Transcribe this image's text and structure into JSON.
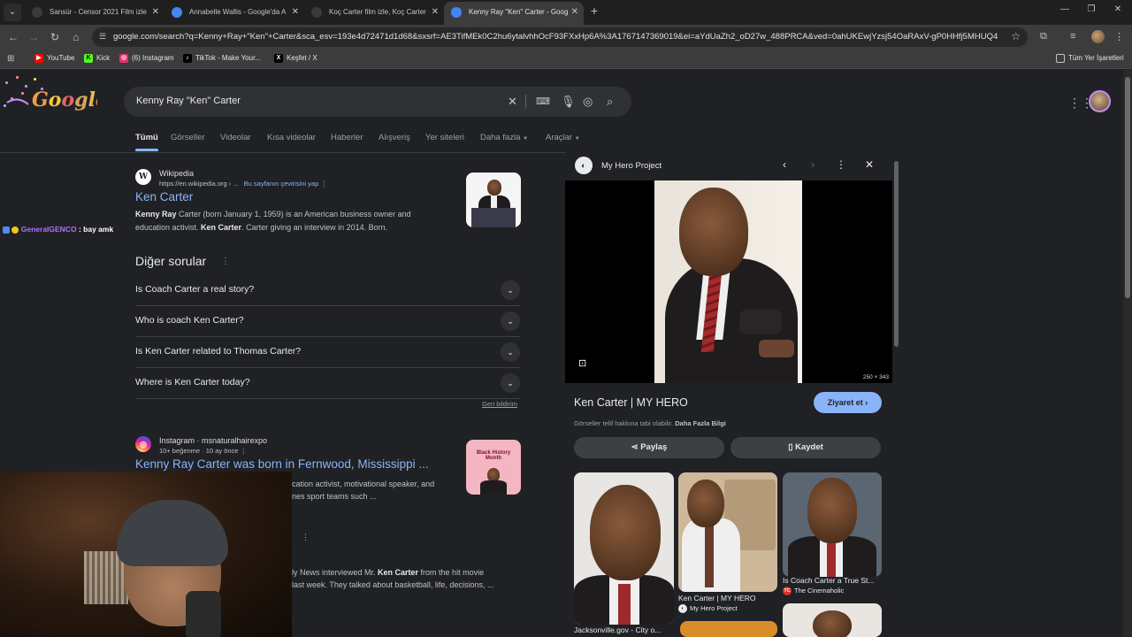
{
  "browser": {
    "tabs": [
      {
        "title": "Sansür - Censor 2021 Film izle",
        "favicon_color": "#3a3a3a",
        "active": false
      },
      {
        "title": "Annabelle Wallis - Google'da A",
        "favicon_color": "#4285f4",
        "active": false
      },
      {
        "title": "Koç Carter film izle, Koç Carter",
        "favicon_color": "#3a3a3a",
        "active": false
      },
      {
        "title": "Kenny Ray \"Ken\" Carter - Goog",
        "favicon_color": "#4285f4",
        "active": true
      }
    ],
    "url": "google.com/search?q=Kenny+Ray+\"Ken\"+Carter&sca_esv=193e4d72471d1d68&sxsrf=AE3TifMEk0C2hu6ytalvhhOcF93FXxHp6A%3A1767147369019&ei=aYdUaZh2_oD27w_488PRCA&ved=0ahUKEwjYzsj54OaRAxV-gP0HHfj5MHUQ4dUDCBI&ua...",
    "bookmarks": [
      {
        "label": "YouTube",
        "color": "#ff0000",
        "glyph": "▶"
      },
      {
        "label": "Kick",
        "color": "#53fc18",
        "glyph": "K"
      },
      {
        "label": "(6) Instagram",
        "color": "#e1306c",
        "glyph": "◎"
      },
      {
        "label": "TikTok - Make Your...",
        "color": "#000000",
        "glyph": "♪"
      },
      {
        "label": "Keşfet / X",
        "color": "#000000",
        "glyph": "X"
      }
    ],
    "all_bookmarks": "Tüm Yer İşaretleri"
  },
  "search": {
    "query": "Kenny Ray \"Ken\" Carter",
    "tabs": [
      "Tümü",
      "Görseller",
      "Videolar",
      "Kısa videolar",
      "Haberler",
      "Alışveriş",
      "Yer siteleri",
      "Daha fazla",
      "Araçlar"
    ]
  },
  "chat_overlay": {
    "user": "GeneralGENCO",
    "message": ": bay amk",
    "user_color": "#a970ff"
  },
  "results": {
    "wiki": {
      "source": "Wikipedia",
      "url": "https://en.wikipedia.org › ...",
      "translate": "Bu sayfanın çevirisini yap",
      "title": "Ken Carter",
      "snippet_parts": [
        {
          "t": "Kenny Ray",
          "b": true
        },
        {
          "t": " Carter (born January 1, 1959) is an American business owner and education activist. ",
          "b": false
        },
        {
          "t": "Ken Carter",
          "b": true
        },
        {
          "t": ". Carter giving an interview in 2014. Born.",
          "b": false
        }
      ]
    },
    "paa": {
      "heading": "Diğer sorular",
      "questions": [
        "Is Coach Carter a real story?",
        "Who is coach Ken Carter?",
        "Is Ken Carter related to Thomas Carter?",
        "Where is Ken Carter today?"
      ],
      "feedback": "Geri bildirim"
    },
    "insta": {
      "source": "Instagram · msnaturalhairexpo",
      "meta": "10+ beğenme · 10 ay önce",
      "title": "Kenny Ray Carter was born in Fernwood, Mississippi ...",
      "snippet_line1": "cation activist, motivational speaker, and",
      "snippet_line2": "nes sport teams such ...",
      "thumb_text": "Black History Month"
    },
    "third": {
      "line1_pre": "ly News interviewed Mr. ",
      "line1_bold": "Ken Carter",
      "line1_post": " from the hit movie",
      "line2": "last week. They talked about basketball, life, decisions, ..."
    }
  },
  "side_panel": {
    "source": "My Hero Project",
    "title": "Ken Carter | MY HERO",
    "visit": "Ziyaret et",
    "copyright": "Görseller telif hakkına tabi olabilir.",
    "more_info": "Daha Fazla Bilgi",
    "dims": "250 × 343",
    "share": "Paylaş",
    "save": "Kaydet",
    "related": [
      {
        "caption": "Jacksonville.gov - City o..."
      },
      {
        "caption": "Ken Carter | MY HERO",
        "source": "My Hero Project"
      },
      {
        "caption": "Is Coach Carter a True St...",
        "source": "The Cinemaholic"
      }
    ]
  }
}
